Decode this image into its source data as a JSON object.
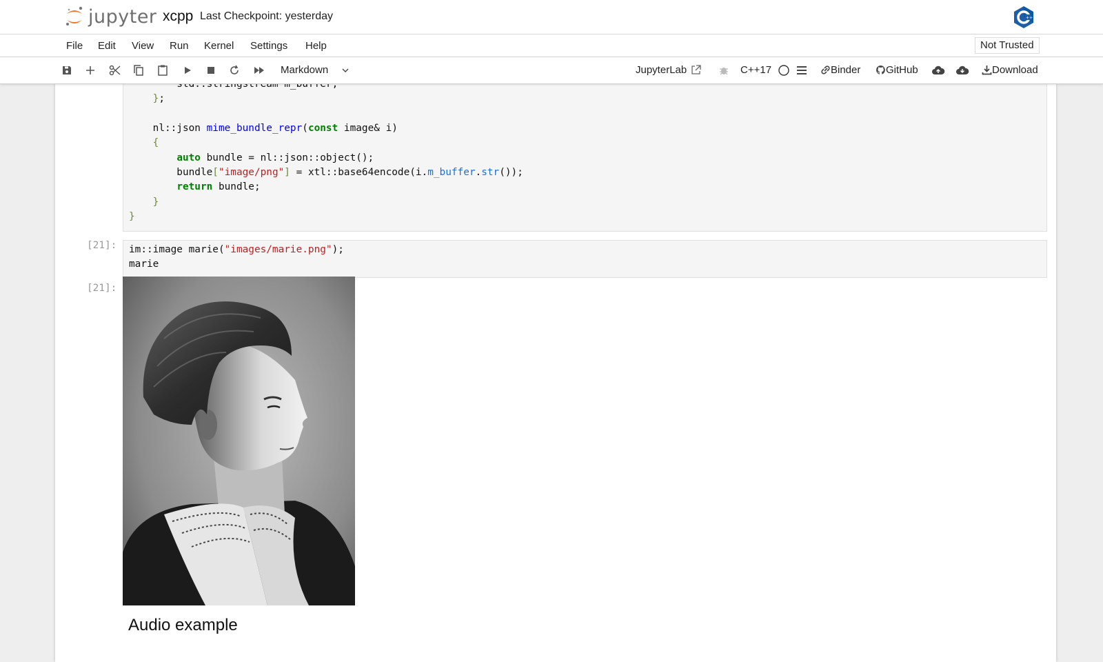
{
  "header": {
    "logo_text": "jupyter",
    "notebook_name": "xcpp",
    "checkpoint": "Last Checkpoint: yesterday"
  },
  "menu": [
    "File",
    "Edit",
    "View",
    "Run",
    "Kernel",
    "Settings",
    "Help"
  ],
  "trust_label": "Not Trusted",
  "toolbar": {
    "cell_type": "Markdown",
    "jupyterlab_label": "JupyterLab",
    "kernel_name": "C++17",
    "binder_label": "Binder",
    "github_label": "GitHub",
    "download_label": "Download"
  },
  "cells": {
    "code1": {
      "lines": [
        "        std::stringstream m_buffer;",
        "    };",
        "",
        "    nl::json mime_bundle_repr(const image& i)",
        "    {",
        "        auto bundle = nl::json::object();",
        "        bundle[\"image/png\"] = xtl::base64encode(i.m_buffer.str());",
        "        return bundle;",
        "    }",
        "}"
      ]
    },
    "code2": {
      "prompt": "[21]:",
      "lines": [
        "im::image marie(\"images/marie.png\");",
        "marie"
      ]
    },
    "output": {
      "prompt": "[21]:"
    },
    "markdown_heading": "Audio example"
  },
  "colors": {
    "keyword": "#008000",
    "function": "#0000ff",
    "string": "#ba2121",
    "member": "#1f6fd8",
    "bracket": "#6a8a3a",
    "jupyter_orange": "#f37726"
  }
}
